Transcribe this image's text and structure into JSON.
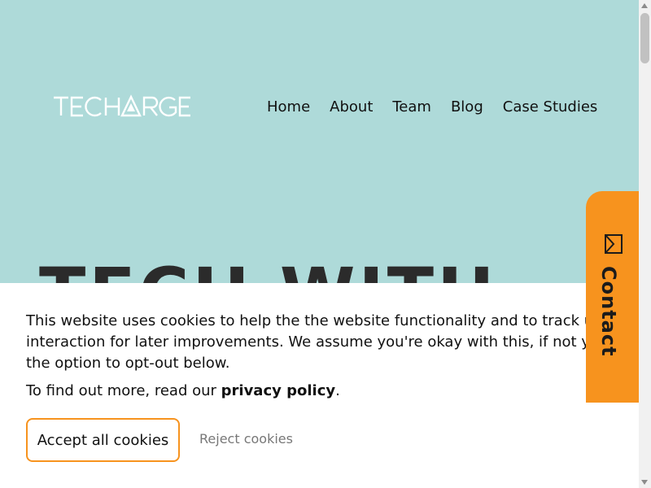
{
  "brand": {
    "logo_text": "TECHARGE",
    "logo_color": "#ffffff",
    "background": "#aedad9",
    "accent": "#f7931e"
  },
  "nav": {
    "items": [
      {
        "label": "Home"
      },
      {
        "label": "About"
      },
      {
        "label": "Team"
      },
      {
        "label": "Blog"
      },
      {
        "label": "Case Studies"
      }
    ]
  },
  "hero": {
    "title": "TECH WITH"
  },
  "contact_tab": {
    "label": "Contact",
    "icon": "message-box-icon"
  },
  "cookie_banner": {
    "line1": "This website uses cookies to help the the website functionality and to track user",
    "line2": "interaction for later improvements. We assume you're okay with this, if not you have",
    "line3": "the option to opt-out below.",
    "policy_prefix": "To find out more, read our ",
    "policy_link": "privacy policy",
    "policy_suffix": ".",
    "accept_label": "Accept all cookies",
    "reject_label": "Reject cookies"
  }
}
